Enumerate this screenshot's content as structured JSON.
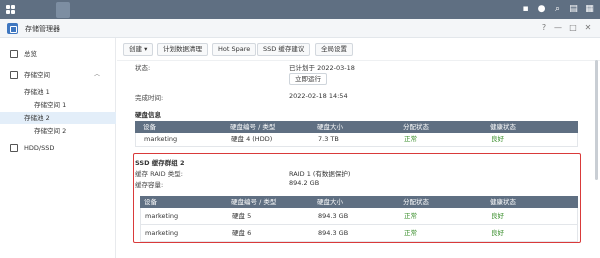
{
  "app": {
    "title": "存储管理器"
  },
  "sidebar": {
    "items": [
      {
        "label": "总览"
      },
      {
        "label": "存储空间"
      },
      {
        "label": "存储池 1"
      },
      {
        "label": "存储空间 1"
      },
      {
        "label": "存储池 2"
      },
      {
        "label": "存储空间 2"
      },
      {
        "label": "HDD/SSD"
      }
    ]
  },
  "toolbar": {
    "create_label": "创建 ▾",
    "schedule_label": "计划数据清理",
    "hotspare_label": "Hot Spare",
    "ssd_label": "SSD 缓存建议",
    "global_label": "全局设置"
  },
  "scrub": {
    "status_label": "状态:",
    "status_value": "已计划于 2022-03-18",
    "run_now_label": "立即运行",
    "completed_label": "完成时间:",
    "completed_value": "2022-02-18 14:54"
  },
  "disk_info": {
    "title": "硬盘信息",
    "headers": [
      "设备",
      "硬盘编号 / 类型",
      "硬盘大小",
      "分配状态",
      "健康状态"
    ],
    "rows": [
      {
        "device": "marketing",
        "disk": "硬盘 4 (HDD)",
        "size": "7.3 TB",
        "allocation": "正常",
        "health": "良好"
      }
    ]
  },
  "ssd_group": {
    "title": "SSD 缓存群组 2",
    "raid_label": "缓存 RAID 类型:",
    "raid_value": "RAID 1 (有数据保护)",
    "capacity_label": "缓存容量:",
    "capacity_value": "894.2 GB",
    "headers": [
      "设备",
      "硬盘编号 / 类型",
      "硬盘大小",
      "分配状态",
      "健康状态"
    ],
    "rows": [
      {
        "device": "marketing",
        "disk": "硬盘 5",
        "size": "894.3 GB",
        "allocation": "正常",
        "health": "良好"
      },
      {
        "device": "marketing",
        "disk": "硬盘 6",
        "size": "894.3 GB",
        "allocation": "正常",
        "health": "良好"
      }
    ]
  },
  "icons": [
    "grid-icon",
    "storage-manager-icon",
    "chat-icon",
    "user-icon",
    "search-icon",
    "widgets-icon",
    "help-icon",
    "minimize-icon",
    "maximize-icon",
    "close-icon",
    "overview-icon",
    "storage-icon",
    "disk-icon",
    "chevron-up-icon"
  ],
  "colors": {
    "taskbar": "#5f6f82",
    "highlight_border": "#d93a3a",
    "ok_text": "#3b8f2d",
    "table_header": "#5f6f82"
  }
}
